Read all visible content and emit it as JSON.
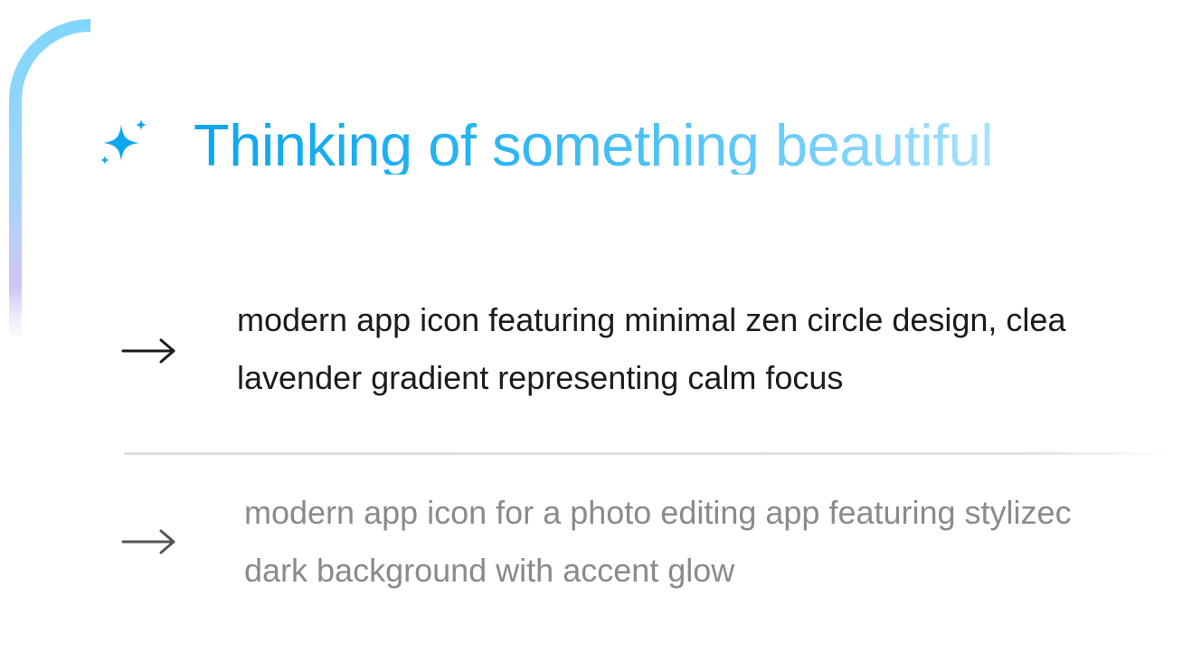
{
  "header": {
    "title": "Thinking of something beautiful",
    "icon": "sparkle-icon",
    "accent_color": "#0aa6ee"
  },
  "suggestions": [
    {
      "line1": "modern app icon featuring minimal zen circle design, clea",
      "line2": "lavender gradient representing calm focus",
      "icon": "arrow-right-icon",
      "text_color": "#1b1b1f"
    },
    {
      "line1": "modern app icon for a photo editing app featuring stylizec",
      "line2": "dark background with accent glow",
      "icon": "arrow-right-icon",
      "text_color": "#8a8a8e"
    }
  ],
  "colors": {
    "frame_gradient": [
      "#7fd6fb",
      "#c8b9f7"
    ],
    "divider": "#dedede"
  }
}
